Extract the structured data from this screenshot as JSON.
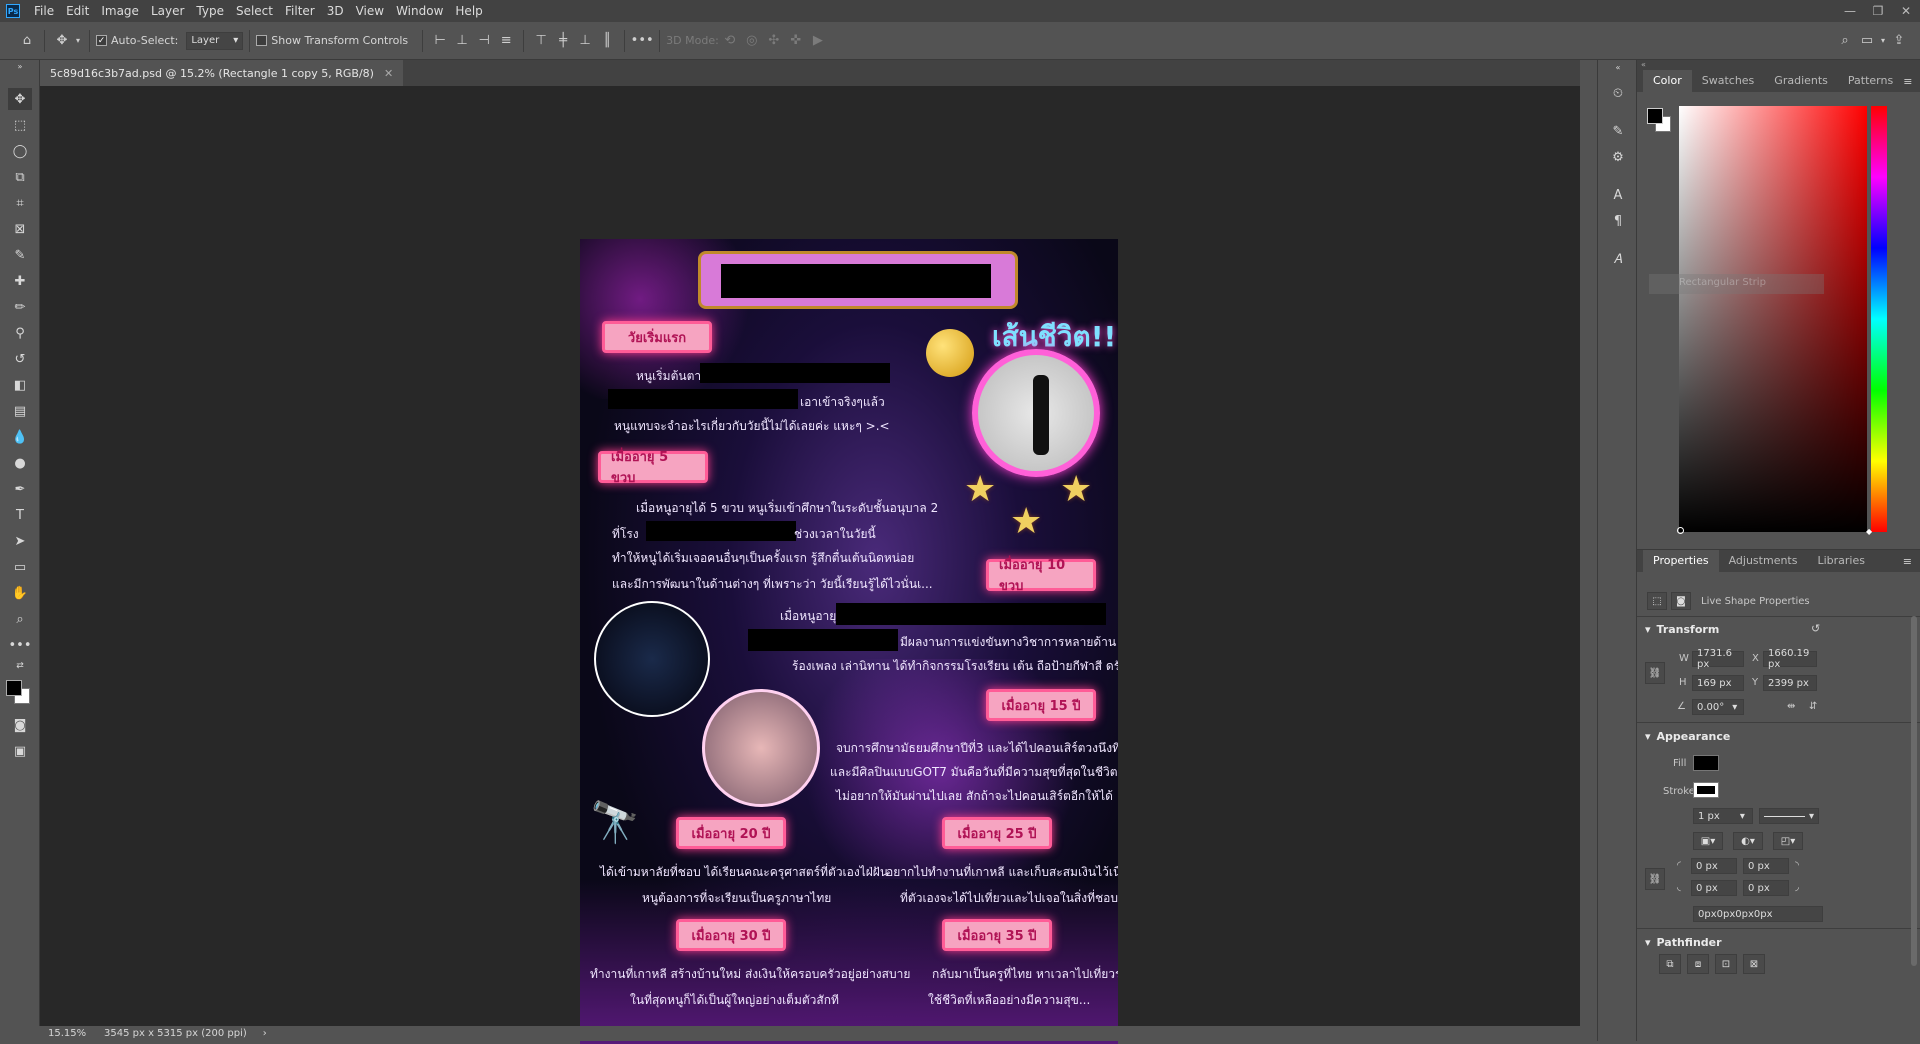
{
  "menubar": {
    "logo": "Ps",
    "items": [
      "File",
      "Edit",
      "Image",
      "Layer",
      "Type",
      "Select",
      "Filter",
      "3D",
      "View",
      "Window",
      "Help"
    ]
  },
  "options": {
    "auto_select_label": "Auto-Select:",
    "auto_select_value": "Layer",
    "transform_label": "Show Transform Controls",
    "mode_label": "3D Mode:"
  },
  "document": {
    "tab_title": "5c89d16c3b7ad.psd @ 15.2% (Rectangle 1 copy 5, RGB/8)"
  },
  "status": {
    "zoom": "15.15%",
    "doc_info": "3545 px x 5315 px (200 ppi)"
  },
  "artwork": {
    "heading": "เส้นชีวิต!!",
    "labels": {
      "first": "วัยเริ่มแรก",
      "age5": "เมื่ออายุ 5 ขวบ",
      "age10": "เมื่ออายุ 10 ขวบ",
      "age15": "เมื่ออายุ 15 ปี",
      "age20": "เมื่ออายุ 20 ปี",
      "age25": "เมื่ออายุ 25 ปี",
      "age30": "เมื่ออายุ 30 ปี",
      "age35": "เมื่ออายุ 35 ปี"
    },
    "text": {
      "l1": "หนูเริ่มต้นตาย",
      "l2": "เอาเข้าจริงๆแล้ว",
      "l3": "หนูแทบจะจำอะไรเกี่ยวกับวัยนี้ไม่ได้เลยค่ะ แหะๆ >.<",
      "l4": "เมื่อหนูอายุได้ 5 ขวบ หนูเริ่มเข้าศึกษาในระดับชั้นอนุบาล 2",
      "l5": "ที่โรง",
      "l6": "ช่วงเวลาในวัยนี้",
      "l7": "ทำให้หนูได้เริ่มเจอคนอื่นๆเป็นครั้งแรก รู้สึกตื่นเต้นนิดหน่อย",
      "l8": "และมีการพัฒนาในด้านต่างๆ ที่เพราะว่า วัยนี้เรียนรู้ได้ไวนั่นเ...",
      "l9": "เมื่อหนูอายุ",
      "l10": "มีผลงานการแข่งขันทางวิชาการหลายด้าน เช่น",
      "l11": "ร้องเพลง เล่านิทาน ได้ทำกิจกรรมโรงเรียน เต้น ถือป้ายกีฬาสี ดรัมเมเยอร์",
      "l12": "จบการศึกษามัธยมศึกษาปีที่3 และได้ไปคอนเสิร์ตวงนึงที่ชอบ",
      "l13": "และมีศิลปินแบบGOT7 มันคือวันที่มีความสุขที่สุดในชีวิต",
      "l14": "ไม่อยากให้มันผ่านไปเลย สักถ้าจะไปคอนเสิร์ตอีกให้ได้",
      "l15": "ได้เข้ามหาลัยที่ชอบ ได้เรียนคณะครุศาสตร์ที่ตัวเองไฝ่ฝัน",
      "l16": "หนูต้องการที่จะเรียนเป็นครูภาษาไทย",
      "l17": "อยากไปทำงานที่เกาหลี และเก็บสะสมเงินไว้เนื่อง",
      "l18": "ที่ตัวเองจะได้ไปเที่ยวและไปเจอในสิ่งที่ชอบ",
      "l19": "ทำงานที่เกาหลี สร้างบ้านใหม่ ส่งเงินให้ครอบครัวอยู่อย่างสบาย",
      "l20": "ในที่สุดหนูก็ได้เป็นผู้ใหญ่อย่างเต็มตัวสักที",
      "l21": "กลับมาเป็นครูที่ไทย หาเวลาไปเที่ยวรอบโลก",
      "l22": "ใช้ชีวิตที่เหลืออย่างมีความสุข..."
    }
  },
  "color_panel": {
    "tabs": [
      "Color",
      "Swatches",
      "Gradients",
      "Patterns"
    ],
    "ghost_layer": "Rectangular Strip"
  },
  "properties_panel": {
    "tabs": [
      "Properties",
      "Adjustments",
      "Libraries"
    ],
    "kind": "Live Shape Properties",
    "transform": {
      "title": "Transform",
      "w_label": "W",
      "w": "1731.6 px",
      "x_label": "X",
      "x": "1660.19 px",
      "h_label": "H",
      "h": "169 px",
      "y_label": "Y",
      "y": "2399 px",
      "angle": "0.00°"
    },
    "appearance": {
      "title": "Appearance",
      "fill_label": "Fill",
      "stroke_label": "Stroke",
      "stroke_width": "1 px",
      "corner1": "0 px",
      "corner2": "0 px",
      "corner3": "0 px",
      "corner4": "0 px",
      "corners_combined": "0px0px0px0px"
    },
    "pathfinder": {
      "title": "Pathfinder"
    }
  },
  "colors": {
    "foreground": "#000000",
    "background": "#ffffff",
    "picker_hue": "#ff0000"
  }
}
